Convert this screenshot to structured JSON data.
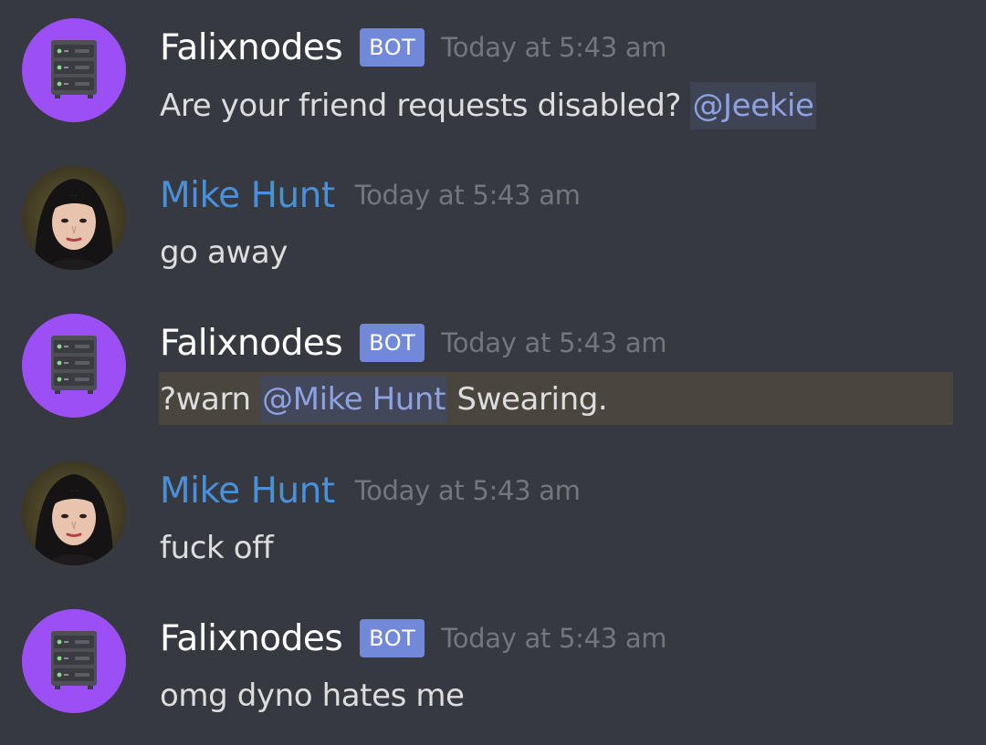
{
  "messages": [
    {
      "author": "Falixnodes",
      "is_bot": true,
      "badge": "BOT",
      "timestamp": "Today at 5:43 am",
      "text_before": "Are your friend requests disabled? ",
      "mention": "@Jeekie",
      "text_after": ""
    },
    {
      "author": "Mike Hunt",
      "is_bot": false,
      "timestamp": "Today at 5:43 am",
      "text_before": "go away"
    },
    {
      "author": "Falixnodes",
      "is_bot": true,
      "badge": "BOT",
      "timestamp": "Today at 5:43 am",
      "highlighted": true,
      "text_before": "?warn ",
      "mention": "@Mike Hunt",
      "text_after": " Swearing."
    },
    {
      "author": "Mike Hunt",
      "is_bot": false,
      "timestamp": "Today at 5:43 am",
      "text_before": "fuck off"
    },
    {
      "author": "Falixnodes",
      "is_bot": true,
      "badge": "BOT",
      "timestamp": "Today at 5:43 am",
      "text_before": "omg dyno hates me"
    }
  ],
  "icons": {
    "bot_avatar": "server-rack-icon",
    "user_avatar": "profile-photo"
  },
  "colors": {
    "background": "#36393f",
    "bot_avatar_bg": "#9c4ff5",
    "user_name": "#4a90d9",
    "bot_badge": "#7289da",
    "mention_text": "#8ea1e1",
    "timestamp": "#72767d",
    "highlight_bg": "#4a463d"
  }
}
